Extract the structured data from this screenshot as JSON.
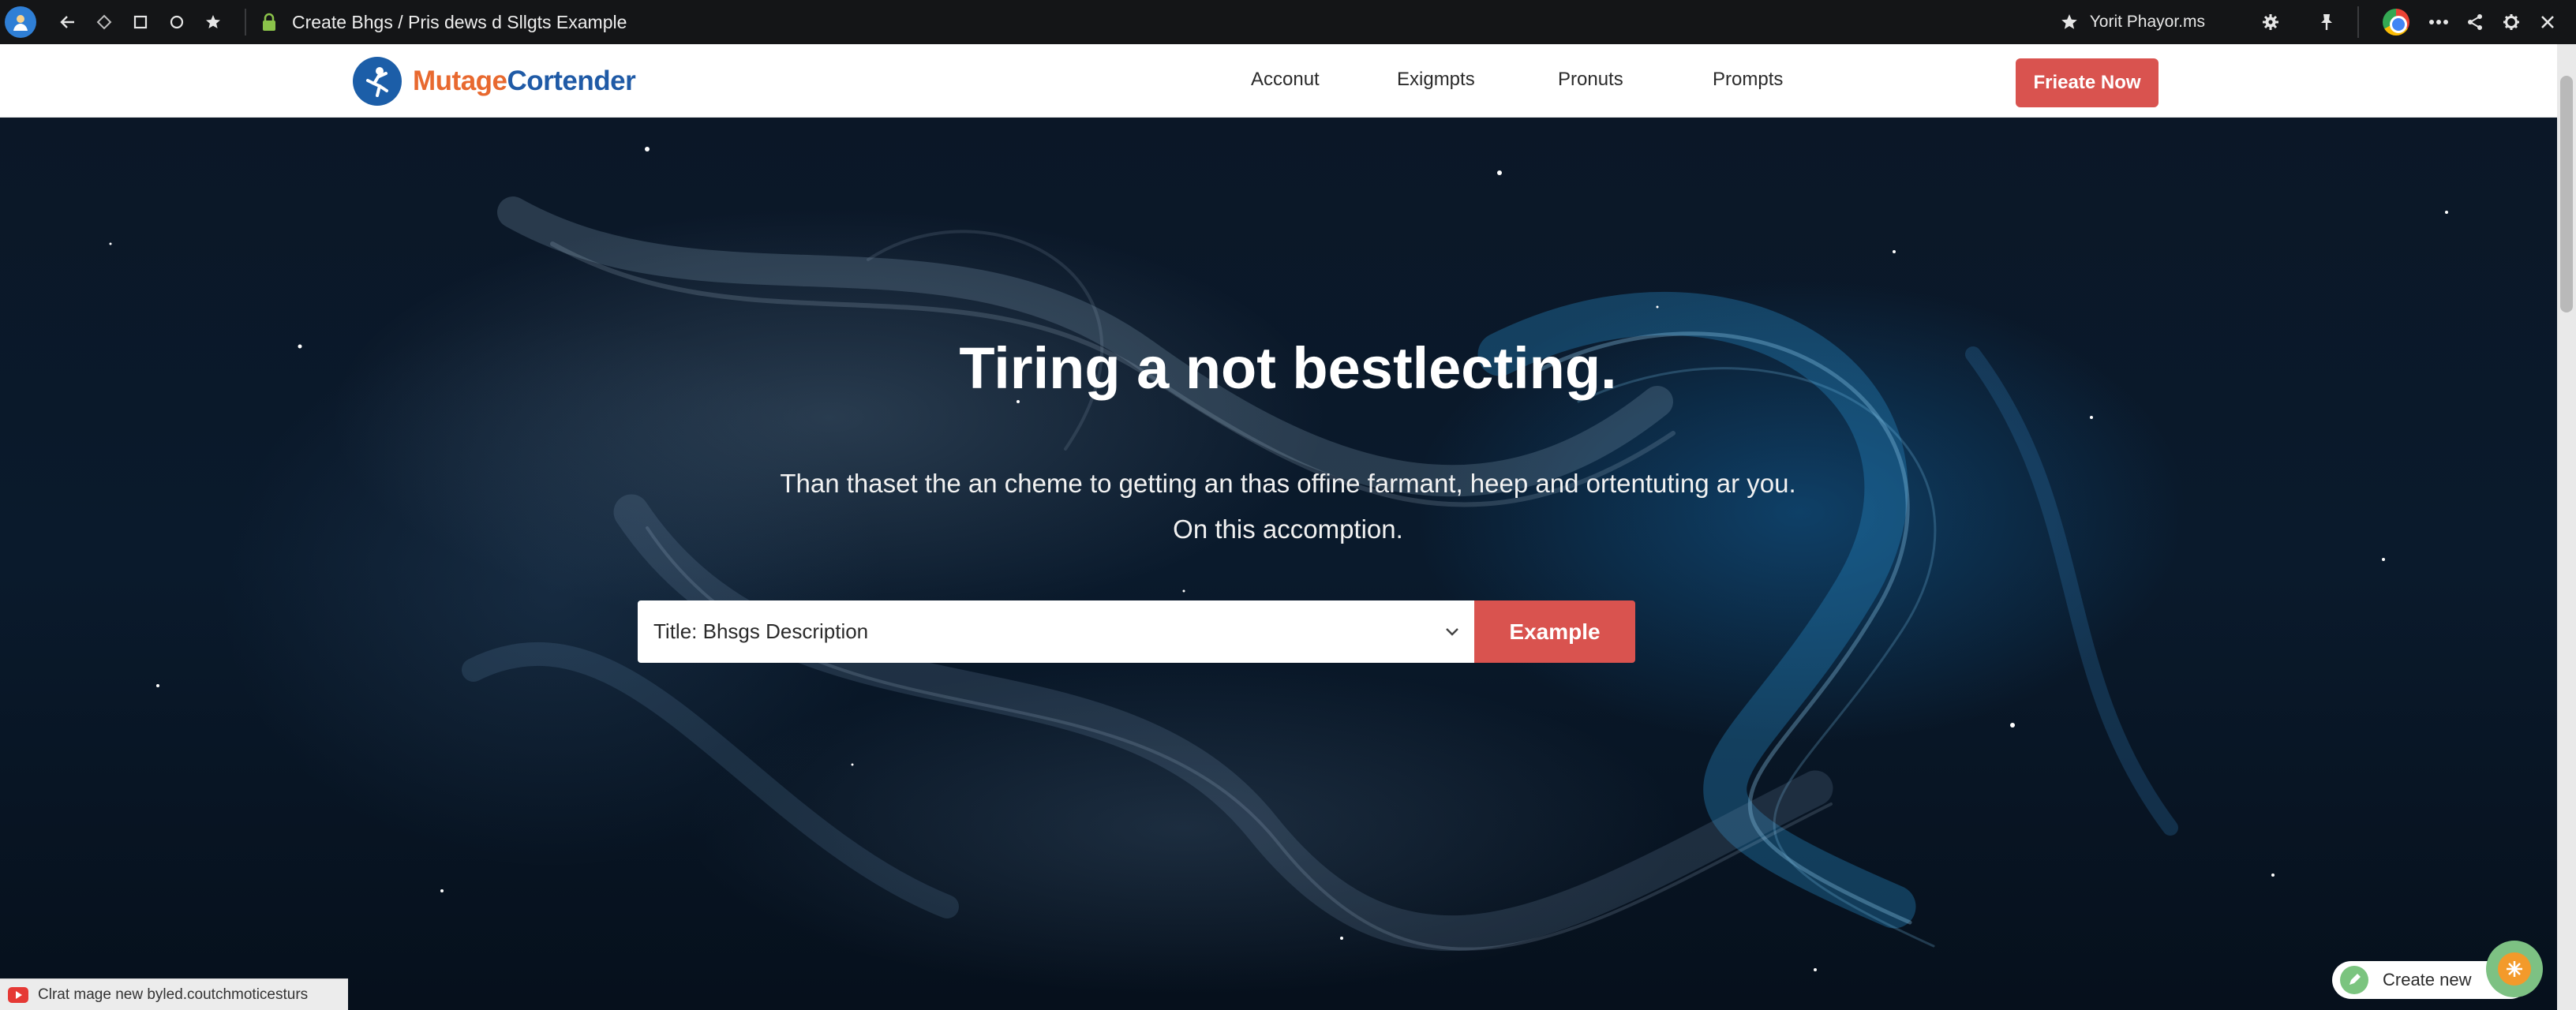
{
  "browser": {
    "tab_title": "Create Bhgs / Pris dews d Sllgts Example",
    "bookmark_label": "Yorit Phayor.ms"
  },
  "site": {
    "logo_part1": "Mutage",
    "logo_part2": "Cortender",
    "nav": [
      "Acconut",
      "Exigmpts",
      "Pronuts",
      "Prompts"
    ],
    "cta_label": "Frieate Now"
  },
  "hero": {
    "headline": "Tiring a not bestlecting.",
    "subtitle_line1": "Than thaset the an cheme to getting an thas offine farmant, heep and ortentuting ar you.",
    "subtitle_line2": "On this accomption.",
    "search_value": "Title: Bhsgs Description",
    "button_label": "Example"
  },
  "status_bar": {
    "text": "Clrat mage new byled.coutchmoticesturs"
  },
  "fab": {
    "label": "Create new"
  },
  "colors": {
    "accent": "#d9534f",
    "logo_orange": "#e8692f",
    "logo_blue": "#1f5aa6",
    "hero_bg": "#0a1a2c"
  }
}
